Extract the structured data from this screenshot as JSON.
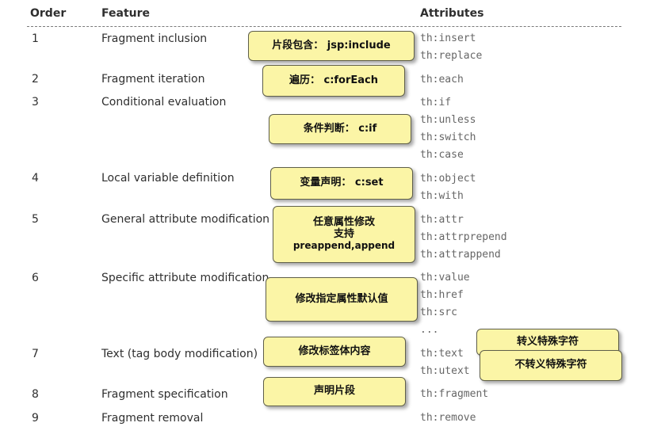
{
  "header": {
    "order": "Order",
    "feature": "Feature",
    "attributes": "Attributes"
  },
  "rows": [
    {
      "order": "1",
      "feature": "Fragment inclusion",
      "attributes": [
        "th:insert",
        "th:replace"
      ]
    },
    {
      "order": "2",
      "feature": "Fragment iteration",
      "attributes": [
        "th:each"
      ]
    },
    {
      "order": "3",
      "feature": "Conditional evaluation",
      "attributes": [
        "th:if",
        "th:unless",
        "th:switch",
        "th:case"
      ]
    },
    {
      "order": "4",
      "feature": "Local variable definition",
      "attributes": [
        "th:object",
        "th:with"
      ]
    },
    {
      "order": "5",
      "feature": "General attribute modification",
      "attributes": [
        "th:attr",
        "th:attrprepend",
        "th:attrappend"
      ]
    },
    {
      "order": "6",
      "feature": "Specific attribute modification",
      "attributes": [
        "th:value",
        "th:href",
        "th:src",
        "..."
      ]
    },
    {
      "order": "7",
      "feature": "Text (tag body modification)",
      "attributes": [
        "th:text",
        "th:utext"
      ]
    },
    {
      "order": "8",
      "feature": "Fragment specification",
      "attributes": [
        "th:fragment"
      ]
    },
    {
      "order": "9",
      "feature": "Fragment removal",
      "attributes": [
        "th:remove"
      ]
    }
  ],
  "notes": {
    "include": "片段包含： jsp:include",
    "foreach": "遍历： c:forEach",
    "if": "条件判断： c:if",
    "set": "变量声明： c:set",
    "attr_line1": "任意属性修改",
    "attr_line2": "支持",
    "attr_line3": "preappend,append",
    "specific": "修改指定属性默认值",
    "text": "修改标签体内容",
    "escape": "转义特殊字符",
    "noescape": "不转义特殊字符",
    "fragment": "声明片段"
  }
}
